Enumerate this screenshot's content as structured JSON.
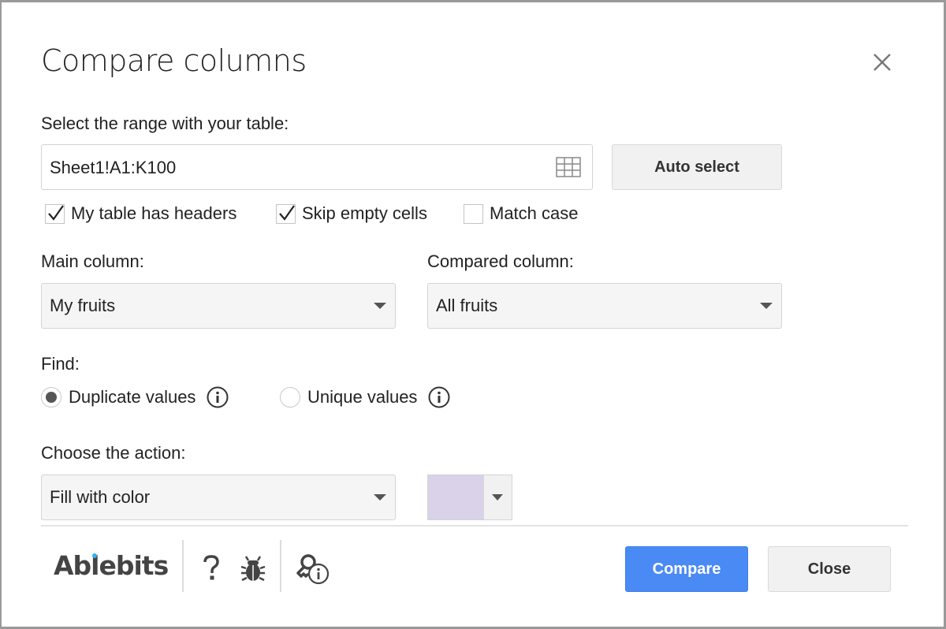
{
  "dialog": {
    "title": "Compare columns",
    "close_icon": "close-icon"
  },
  "range": {
    "label": "Select the range with your table:",
    "value": "Sheet1!A1:K100",
    "picker_icon": "grid-icon",
    "auto_select_label": "Auto select"
  },
  "options": [
    {
      "label": "My table has headers",
      "checked": true
    },
    {
      "label": "Skip empty cells",
      "checked": true
    },
    {
      "label": "Match case",
      "checked": false
    }
  ],
  "main_column": {
    "label": "Main column:",
    "selected": "My fruits"
  },
  "compared_column": {
    "label": "Compared column:",
    "selected": "All fruits"
  },
  "find": {
    "label": "Find:",
    "choices": [
      {
        "label": "Duplicate values",
        "selected": true,
        "icon": "info-icon"
      },
      {
        "label": "Unique values",
        "selected": false,
        "icon": "info-icon"
      }
    ]
  },
  "action": {
    "label": "Choose the action:",
    "selected": "Fill with color",
    "fill_color": "#d9d2e9"
  },
  "footer": {
    "brand": "Ablebits",
    "brand_dot_color": "#33b4e8",
    "help_icon": "question-icon",
    "bug_icon": "bug-icon",
    "license_icon": "key-info-icon",
    "compare_label": "Compare",
    "close_label": "Close"
  },
  "colors": {
    "primary": "#4a8af4",
    "secondary_button": "#f1f1f1",
    "select_bg": "#f5f5f5"
  }
}
